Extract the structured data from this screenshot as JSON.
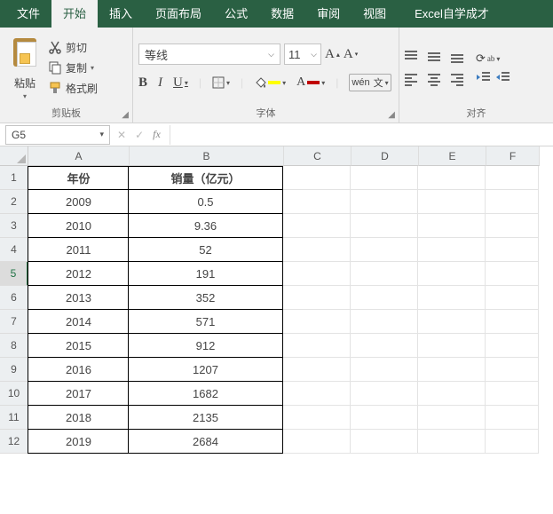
{
  "tabs": {
    "file": "文件",
    "home": "开始",
    "insert": "插入",
    "layout": "页面布局",
    "formula": "公式",
    "data": "数据",
    "review": "审阅",
    "view": "视图",
    "selfstudy": "Excel自学成才"
  },
  "clipboard": {
    "group_label": "剪贴板",
    "paste_label": "粘贴",
    "cut_label": "剪切",
    "copy_label": "复制",
    "formatpainter_label": "格式刷"
  },
  "font": {
    "group_label": "字体",
    "name": "等线",
    "size": "11",
    "wen_label": "wén"
  },
  "align": {
    "group_label": "对齐"
  },
  "formula_bar": {
    "cellref": "G5",
    "value": ""
  },
  "columns": [
    "A",
    "B",
    "C",
    "D",
    "E",
    "F"
  ],
  "row_numbers": [
    "1",
    "2",
    "3",
    "4",
    "5",
    "6",
    "7",
    "8",
    "9",
    "10",
    "11",
    "12"
  ],
  "chart_data": {
    "type": "table",
    "headers": [
      "年份",
      "销量（亿元）"
    ],
    "rows": [
      [
        "2009",
        "0.5"
      ],
      [
        "2010",
        "9.36"
      ],
      [
        "2011",
        "52"
      ],
      [
        "2012",
        "191"
      ],
      [
        "2013",
        "352"
      ],
      [
        "2014",
        "571"
      ],
      [
        "2015",
        "912"
      ],
      [
        "2016",
        "1207"
      ],
      [
        "2017",
        "1682"
      ],
      [
        "2018",
        "2135"
      ],
      [
        "2019",
        "2684"
      ]
    ]
  },
  "colors": {
    "accent": "#217346",
    "font_highlight": "#ffff00",
    "font_color": "#c00000"
  }
}
